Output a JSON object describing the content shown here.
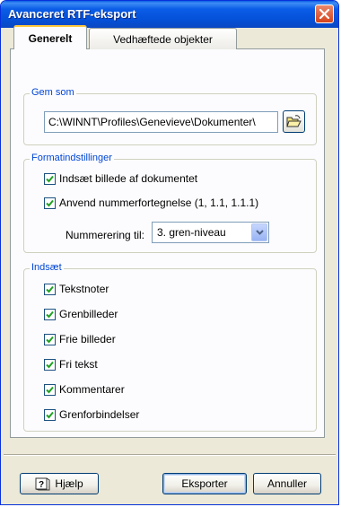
{
  "window": {
    "title": "Avanceret RTF-eksport"
  },
  "tabs": [
    {
      "label": "Generelt",
      "active": true
    },
    {
      "label": "Vedhæftede objekter",
      "active": false
    }
  ],
  "save_group": {
    "title": "Gem som",
    "path_value": "C:\\WINNT\\Profiles\\Genevieve\\Dokumenter\\"
  },
  "format_group": {
    "title": "Formatindstillinger",
    "insert_image_label": "Indsæt billede af dokumentet",
    "insert_image_checked": true,
    "numbering_label": "Anvend nummerfortegnelse (1, 1.1, 1.1.1)",
    "numbering_checked": true,
    "numbering_to_label": "Nummerering til:",
    "numbering_to_value": "3. gren-niveau"
  },
  "insert_group": {
    "title": "Indsæt",
    "items": [
      {
        "label": "Tekstnoter",
        "checked": true
      },
      {
        "label": "Grenbilleder",
        "checked": true
      },
      {
        "label": "Frie billeder",
        "checked": true
      },
      {
        "label": "Fri tekst",
        "checked": true
      },
      {
        "label": "Kommentarer",
        "checked": true
      },
      {
        "label": "Grenforbindelser",
        "checked": true
      }
    ]
  },
  "buttons": {
    "help": "Hjælp",
    "export": "Eksporter",
    "cancel": "Annuller"
  },
  "colors": {
    "titlebar": "#0551d8",
    "group_title": "#0046d5",
    "checkmark": "#21a121"
  }
}
